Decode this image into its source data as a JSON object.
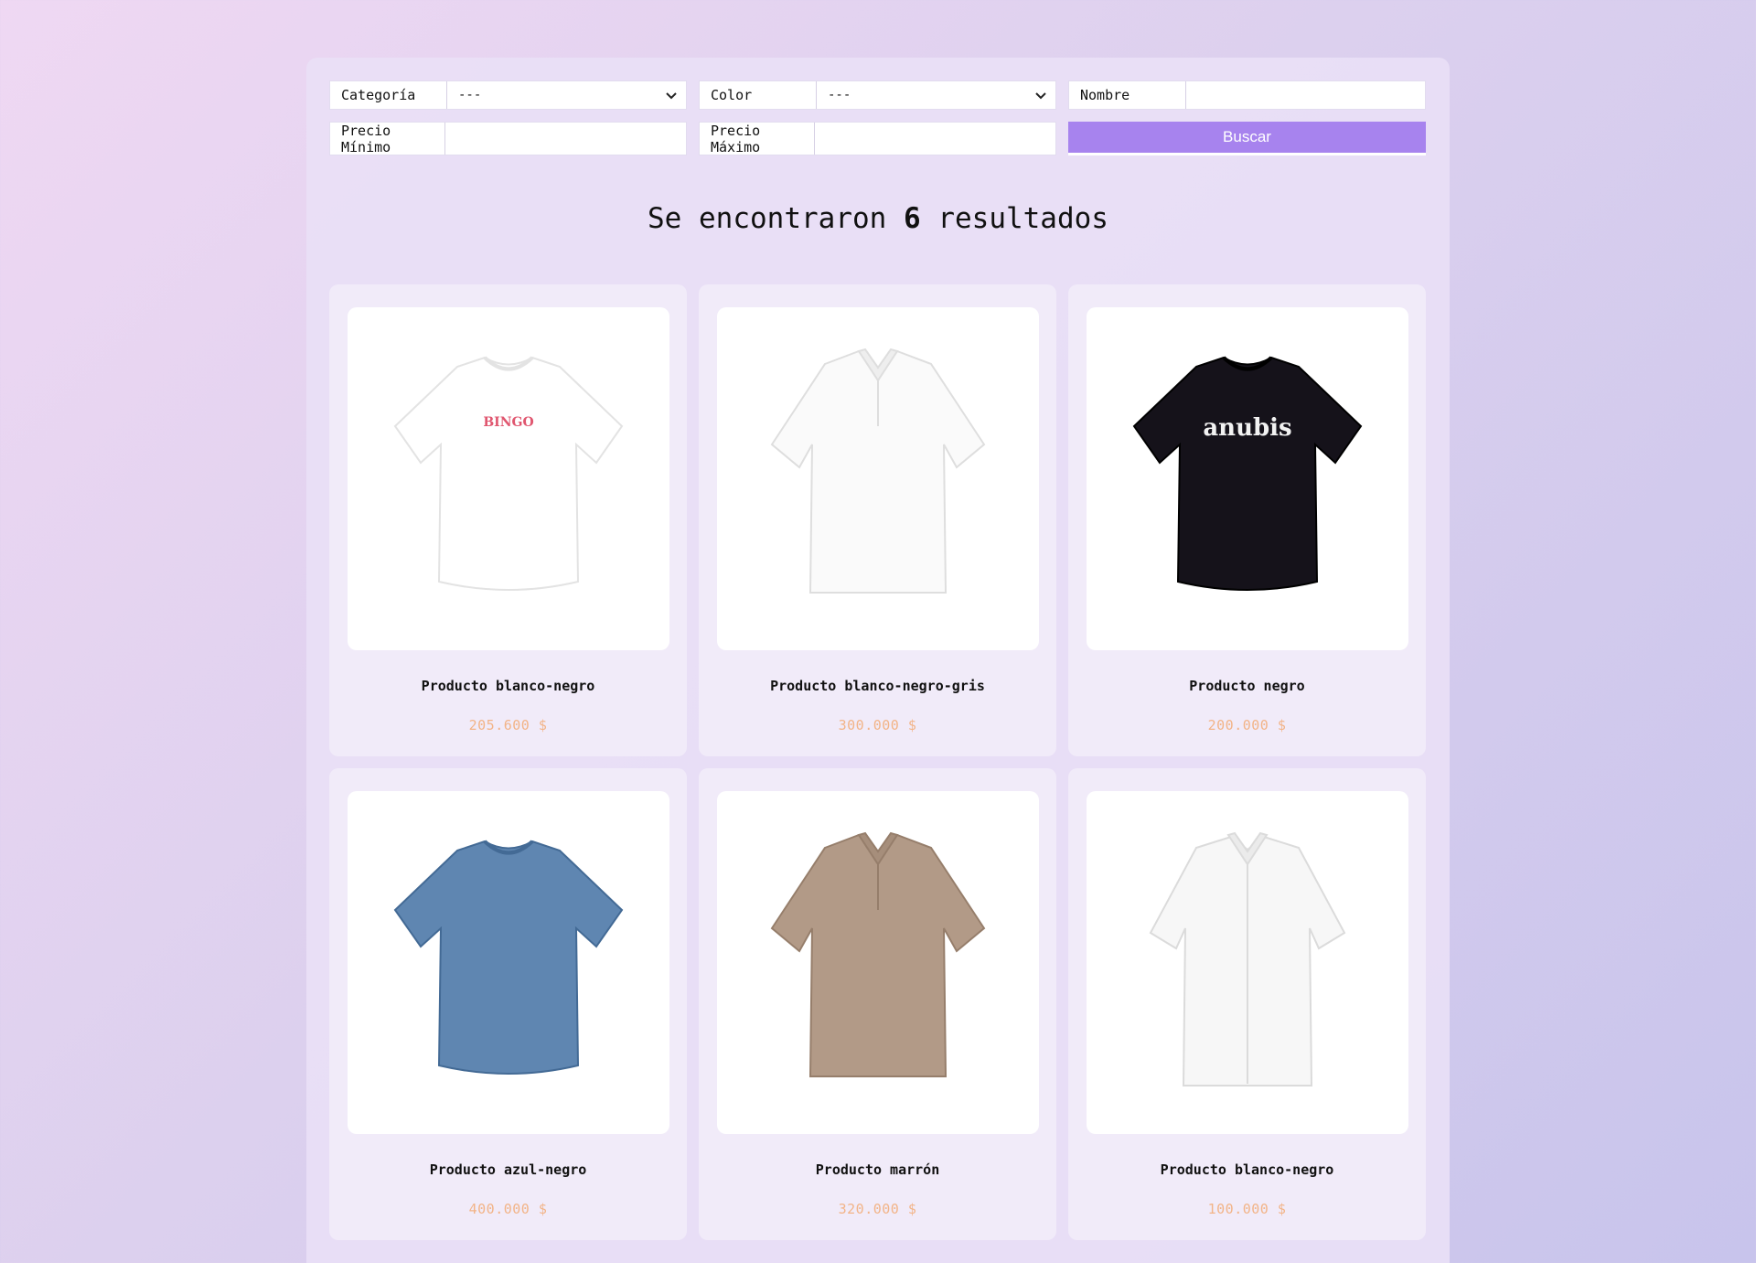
{
  "filters": {
    "category": {
      "label": "Categoría",
      "value": "---"
    },
    "color": {
      "label": "Color",
      "value": "---"
    },
    "name": {
      "label": "Nombre",
      "value": ""
    },
    "price_min": {
      "label": "Precio Mínimo",
      "value": ""
    },
    "price_max": {
      "label": "Precio Máximo",
      "value": ""
    },
    "search_label": "Buscar"
  },
  "results": {
    "prefix": "Se encontraron",
    "count": "6",
    "suffix": "resultados"
  },
  "products": [
    {
      "name": "Producto blanco-negro",
      "price": "205.600 $",
      "shirt_color": "#ffffff",
      "style": "tee",
      "print": "BINGO"
    },
    {
      "name": "Producto blanco-negro-gris",
      "price": "300.000 $",
      "shirt_color": "#fafafa",
      "style": "polo"
    },
    {
      "name": "Producto negro",
      "price": "200.000 $",
      "shirt_color": "#15121a",
      "style": "tee",
      "print": "anubis"
    },
    {
      "name": "Producto azul-negro",
      "price": "400.000 $",
      "shirt_color": "#5f86b1",
      "style": "tee"
    },
    {
      "name": "Producto marrón",
      "price": "320.000 $",
      "shirt_color": "#b29a87",
      "style": "polo"
    },
    {
      "name": "Producto blanco-negro",
      "price": "100.000 $",
      "shirt_color": "#f7f7f7",
      "style": "shirt"
    }
  ],
  "colors": {
    "accent": "#a783ee",
    "price": "#f2b488"
  }
}
